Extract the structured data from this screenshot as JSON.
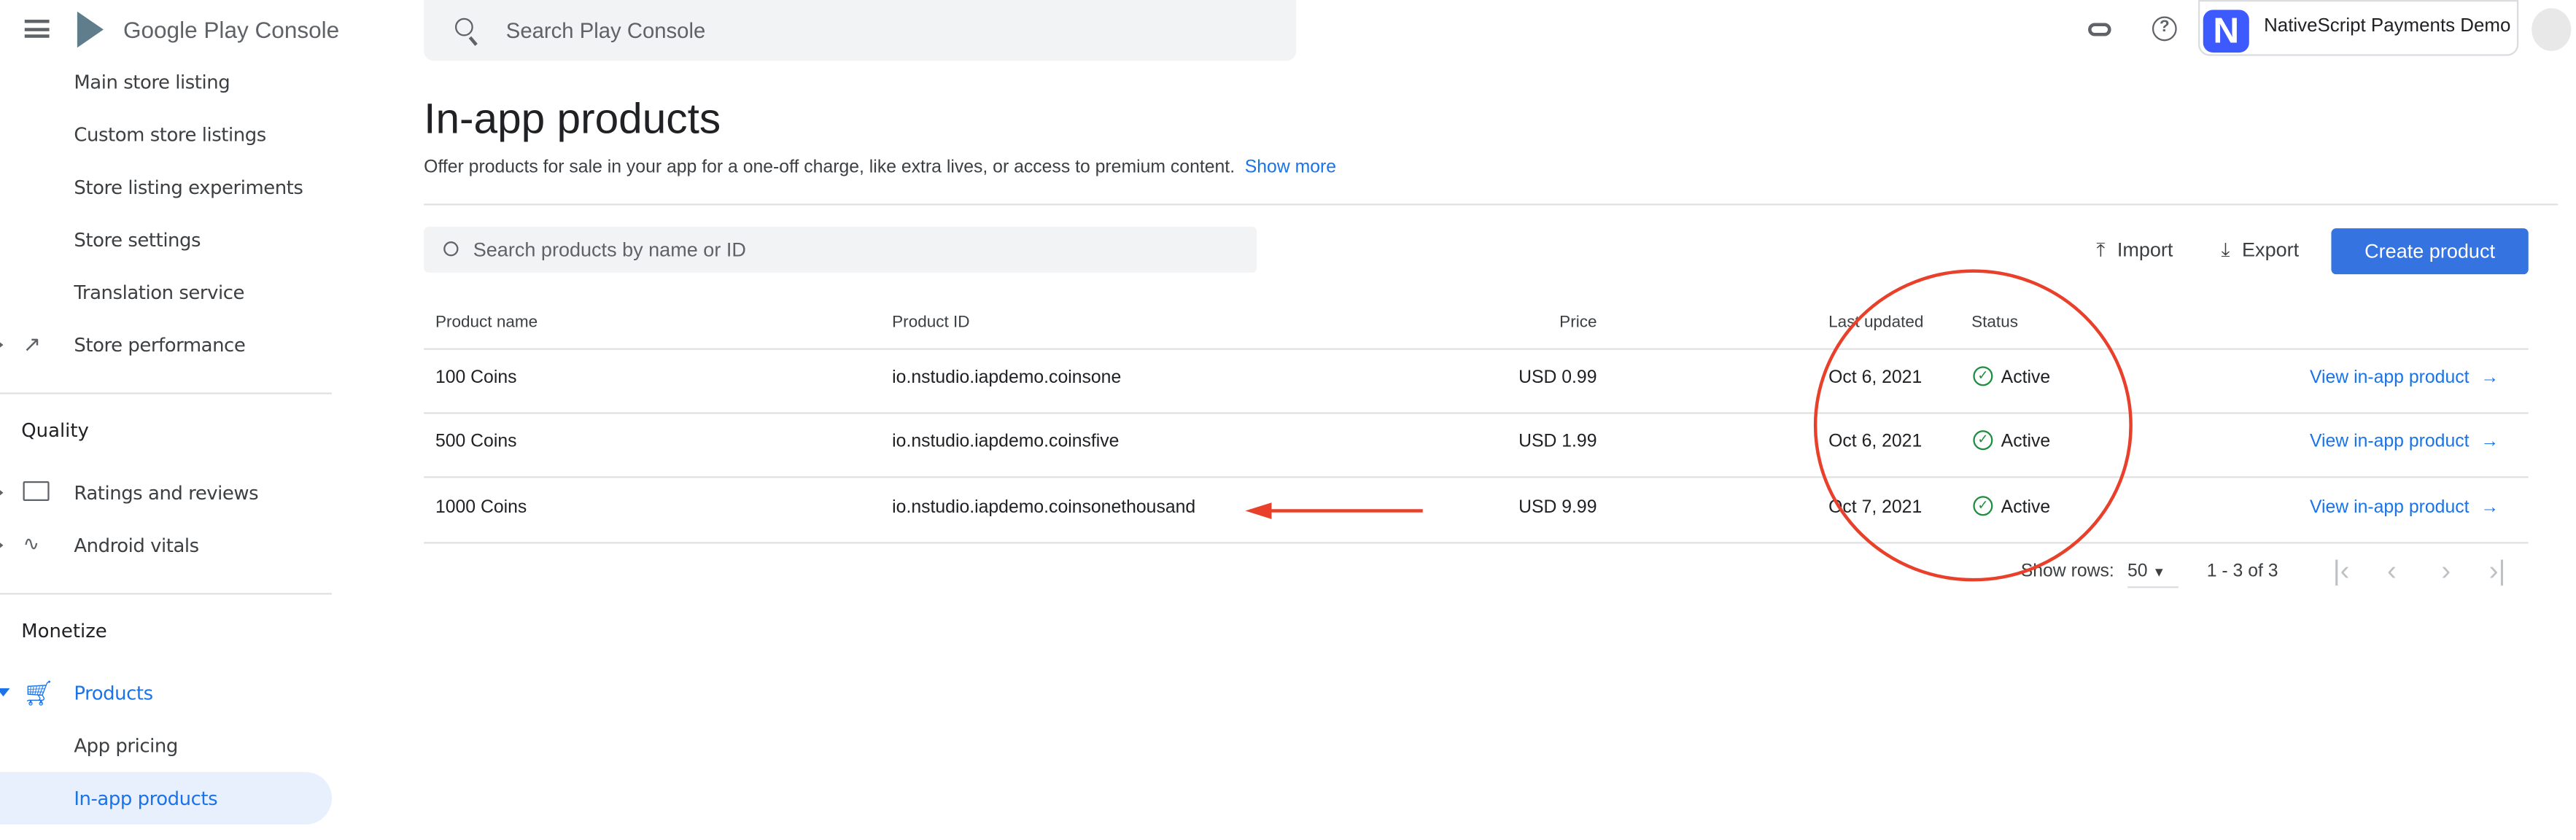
{
  "header": {
    "brand": "Google Play Console",
    "search_placeholder": "Search Play Console",
    "app_name": "NativeScript Payments Demo",
    "app_icon_letter": "N",
    "icons": [
      "menu-icon",
      "link-icon",
      "help-icon",
      "avatar-icon"
    ]
  },
  "sidebar": {
    "store_items": [
      "Main store listing",
      "Custom store listings",
      "Store listing experiments",
      "Store settings",
      "Translation service"
    ],
    "store_performance": "Store performance",
    "quality": {
      "title": "Quality",
      "items": [
        "Ratings and reviews",
        "Android vitals"
      ]
    },
    "monetize": {
      "title": "Monetize",
      "products": "Products",
      "items": [
        "App pricing",
        "In-app products"
      ]
    },
    "active_item": "In-app products"
  },
  "main": {
    "title": "In-app products",
    "description": "Offer products for sale in your app for a one-off charge, like extra lives, or access to premium content.",
    "show_more": "Show more",
    "search_placeholder": "Search products by name or ID",
    "import_label": "Import",
    "export_label": "Export",
    "create_label": "Create product",
    "columns": [
      "Product name",
      "Product ID",
      "Price",
      "Last updated",
      "Status"
    ],
    "rows": [
      {
        "name": "100 Coins",
        "id": "io.nstudio.iapdemo.coinsone",
        "price": "USD 0.99",
        "updated": "Oct 6, 2021",
        "status": "Active",
        "action": "View in-app product"
      },
      {
        "name": "500 Coins",
        "id": "io.nstudio.iapdemo.coinsfive",
        "price": "USD 1.99",
        "updated": "Oct 6, 2021",
        "status": "Active",
        "action": "View in-app product"
      },
      {
        "name": "1000 Coins",
        "id": "io.nstudio.iapdemo.coinsonethousand",
        "price": "USD 9.99",
        "updated": "Oct 7, 2021",
        "status": "Active",
        "action": "View in-app product"
      }
    ],
    "pagination": {
      "show_rows_label": "Show rows:",
      "rows_value": "50",
      "range": "1 - 3 of 3"
    }
  },
  "colors": {
    "accent": "#1a73e8",
    "button": "#3574e0",
    "annotation": "#e8402a",
    "status_ok": "#1e8e3e",
    "active_bg": "#e8f0fe"
  }
}
